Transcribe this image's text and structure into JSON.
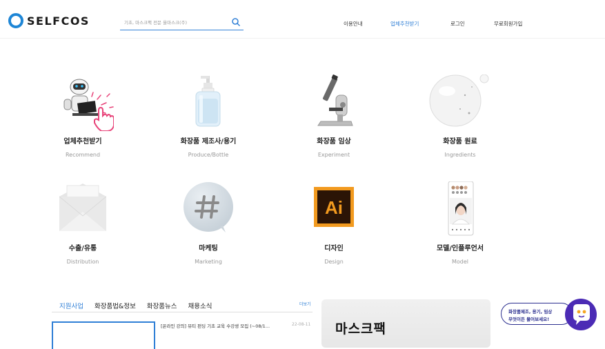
{
  "header": {
    "logo_text": "SELFCOS",
    "search_placeholder": "기초, 마스크팩 전문 올마스크(주)",
    "nav": [
      "이용안내",
      "업체추천받기",
      "로그인",
      "무료회원가입"
    ],
    "active_nav_index": 1
  },
  "categories": [
    {
      "title": "업체추천받기",
      "subtitle": "Recommend",
      "icon": "robot-icon"
    },
    {
      "title": "화장품 제조사/용기",
      "subtitle": "Produce/Bottle",
      "icon": "pump-bottle-icon"
    },
    {
      "title": "화장품 임상",
      "subtitle": "Experiment",
      "icon": "microscope-icon"
    },
    {
      "title": "화장품 원료",
      "subtitle": "Ingredients",
      "icon": "serum-drop-icon"
    },
    {
      "title": "수출/유통",
      "subtitle": "Distribution",
      "icon": "envelope-icon"
    },
    {
      "title": "마케팅",
      "subtitle": "Marketing",
      "icon": "hashtag-icon"
    },
    {
      "title": "디자인",
      "subtitle": "Design",
      "icon": "illustrator-icon"
    },
    {
      "title": "모델/인플루언서",
      "subtitle": "Model",
      "icon": "phone-model-icon"
    }
  ],
  "news": {
    "tabs": [
      "지원사업",
      "화장품법&정보",
      "화장품뉴스",
      "채용소식"
    ],
    "active_tab_index": 0,
    "more_label": "더보기",
    "items": [
      {
        "title": "[온라인 강의] 뷰티 펀딩 기초 교육 수강생 모집 (~08/1...",
        "date": "22-08-11"
      }
    ]
  },
  "banner": {
    "text": "마스크팩"
  },
  "chat": {
    "line1": "화장품제조, 용기, 임상",
    "line2": "무엇이든 물어보세요!"
  },
  "colors": {
    "brand": "#1e86d6",
    "accent": "#2f7fd6",
    "chat": "#2b2f8f",
    "hand": "#e8457a"
  }
}
